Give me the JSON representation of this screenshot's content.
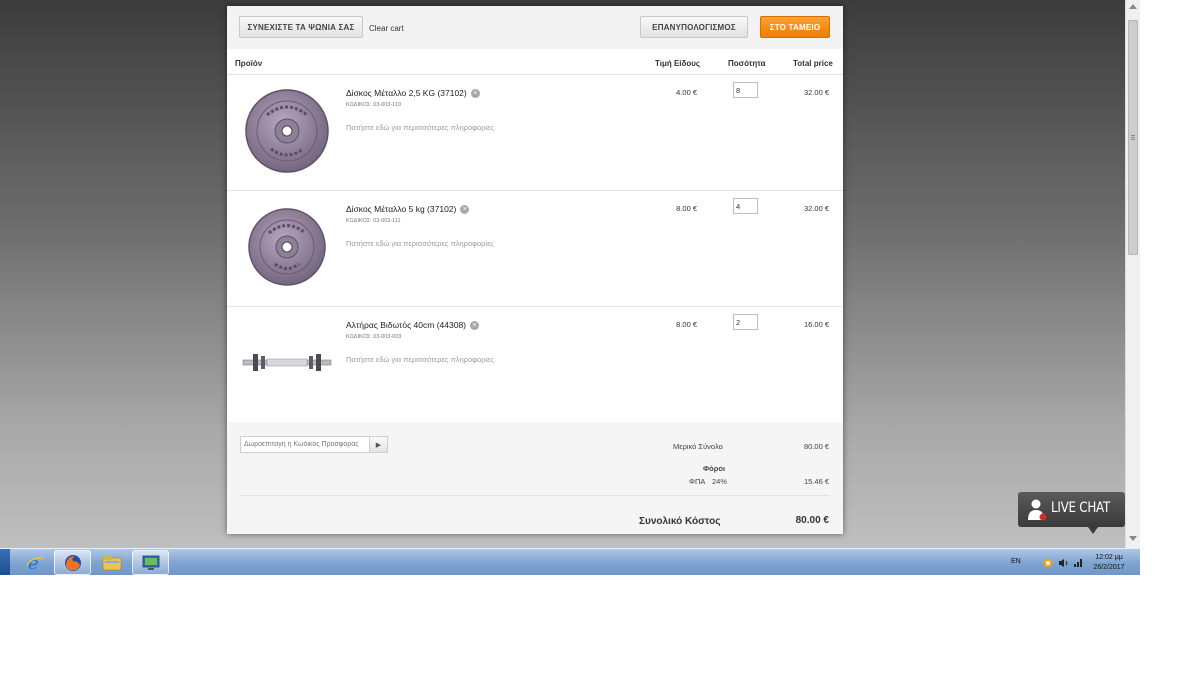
{
  "toolbar": {
    "continue_label": "ΣΥΝΕΧΙΣΤΕ ΤΑ ΨΩΝΙΑ ΣΑΣ",
    "clear_label": "Clear cart",
    "recalculate_label": "ΕΠΑΝΥΠΟΛΟΓΙΣΜΟΣ",
    "checkout_label": "ΣΤΟ ΤΑΜΕΙΟ"
  },
  "columns": {
    "product": "Προϊόν",
    "unit_price": "Τιμή Είδους",
    "quantity": "Ποσότητα",
    "total": "Total price"
  },
  "items": [
    {
      "name": "Δίσκος Μέταλλο 2,5 KG (37102)",
      "code": "ΚΩΔΙΚΟΣ: 03-003-110",
      "info": "Πατήστε εδώ για περισσότερες πληροφορίες",
      "price": "4.00 €",
      "qty": "8",
      "total": "32.00 €"
    },
    {
      "name": "Δίσκος Μέταλλο 5 kg (37102)",
      "code": "ΚΩΔΙΚΟΣ: 03-003-111",
      "info": "Πατήστε εδώ για περισσότερες πληροφορίες",
      "price": "8.00 €",
      "qty": "4",
      "total": "32.00 €"
    },
    {
      "name": "Αλτήρας Βιδωτός 40cm (44308)",
      "code": "ΚΩΔΙΚΟΣ: 03-003-003",
      "info": "Πατήστε εδώ για περισσότερες πληροφορίες",
      "price": "8.00 €",
      "qty": "2",
      "total": "16.00 €"
    }
  ],
  "footer": {
    "coupon_placeholder": "Δωροεπιταγή ή Κωδικός Προσφοράς",
    "subtotal_label": "Μερικό Σύνολο",
    "subtotal_value": "80.00 €",
    "taxes_label": "Φόροι",
    "vat_label": "ΦΠΑ",
    "vat_rate": "24%",
    "vat_value": "15.46 €",
    "grand_total_label": "Συνολικό Κόστος",
    "grand_total_value": "80.00 €"
  },
  "livechat": {
    "label": "LIVE CHAT"
  },
  "taskbar": {
    "language": "EN",
    "time": "12:02 μμ",
    "date": "26/2/2017"
  },
  "colors": {
    "accent_orange": "#f07d00",
    "taskbar_blue": "#7ea3d0"
  }
}
